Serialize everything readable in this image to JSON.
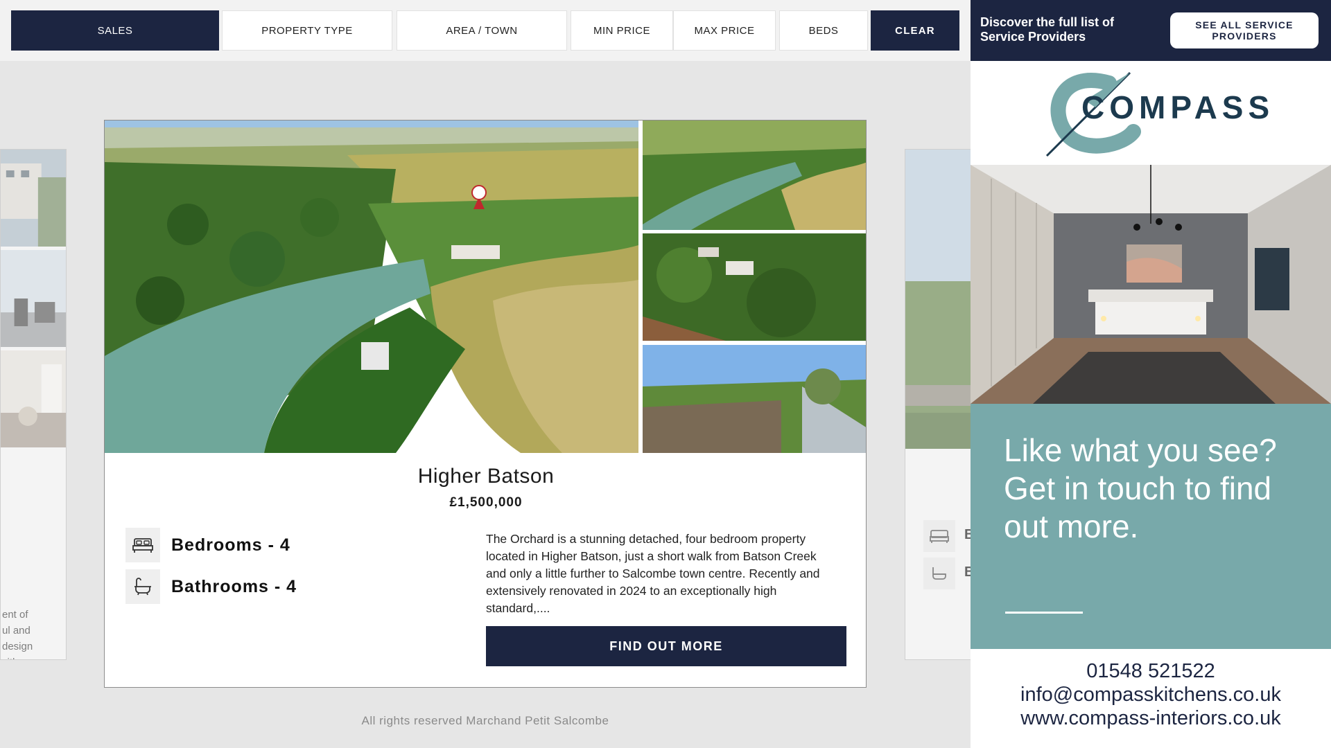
{
  "filters": {
    "sales": "SALES",
    "property_type": "PROPERTY TYPE",
    "area_town": "AREA / TOWN",
    "min_price": "MIN PRICE",
    "max_price": "MAX PRICE",
    "beds": "BEDS",
    "clear": "CLEAR"
  },
  "left_card": {
    "text": "ent of\nul and\ndesign\nvith"
  },
  "right_card": {
    "bed_letter": "B",
    "bath_letter": "B"
  },
  "property": {
    "title": "Higher Batson",
    "price": "£1,500,000",
    "bedrooms": "Bedrooms - 4",
    "bathrooms": "Bathrooms - 4",
    "description": "The Orchard is a stunning detached, four bedroom property located in Higher Batson, just a short walk from Batson Creek and only a little further to Salcombe town centre. Recently and extensively renovated in 2024 to an exceptionally high standard,....",
    "cta": "FIND OUT MORE"
  },
  "footer": "All rights reserved Marchand Petit Salcombe",
  "ad": {
    "header_text": "Discover the full list of\nService Providers",
    "see_all": "SEE ALL SERVICE\nPROVIDERS",
    "logo_text": "COMPASS",
    "headline": "Like what you see? Get in touch to find out more.",
    "phone": "01548 521522",
    "email": "info@compasskitchens.co.uk",
    "website": "www.compass-interiors.co.uk"
  },
  "colors": {
    "navy": "#1c2541",
    "teal": "#78a9aa",
    "page_bg": "#e6e6e6"
  }
}
